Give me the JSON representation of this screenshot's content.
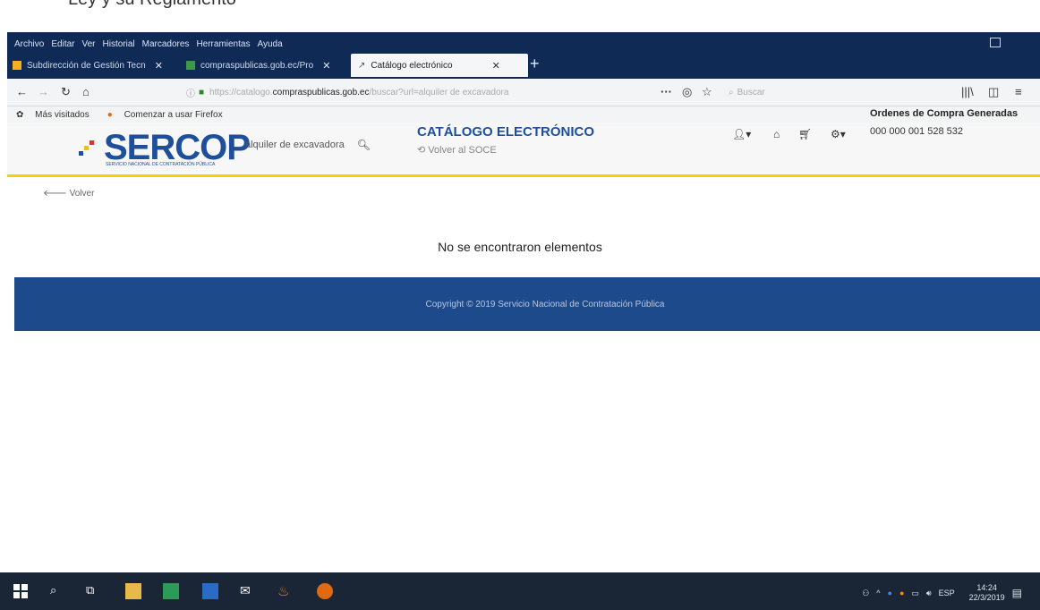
{
  "doc_text": "Ley y su Reglamento",
  "menubar": {
    "items": [
      "Archivo",
      "Editar",
      "Ver",
      "Historial",
      "Marcadores",
      "Herramientas",
      "Ayuda"
    ]
  },
  "tabs": [
    {
      "label": "Subdirección de Gestión Tecn",
      "active": false
    },
    {
      "label": "compraspublicas.gob.ec/Pro",
      "active": false
    },
    {
      "label": "Catálogo electrónico",
      "active": true
    }
  ],
  "navbar": {
    "url_domain": "compraspublicas.gob.ec",
    "url_rest": "/buscar?url=alquiler de excavadora",
    "search_placeholder": "Buscar"
  },
  "bookmarks": {
    "items": [
      "Más visitados",
      "Comenzar a usar Firefox"
    ]
  },
  "site": {
    "logo_text": "SERCOP",
    "logo_sub": "SERVICIO NACIONAL DE CONTRATACIÓN PÚBLICA",
    "search_value": "alquiler de excavadora",
    "catalog_title": "CATÁLOGO ELECTRÓNICO",
    "back_soce": "Volver al SOCE",
    "orders_title": "Ordenes de Compra Generadas",
    "orders_number": "000 000 001 528 532"
  },
  "content": {
    "back_label": "Volver",
    "empty_message": "No se encontraron elementos"
  },
  "footer": {
    "copyright": "Copyright © 2019 Servicio Nacional de Contratación Pública"
  },
  "taskbar": {
    "lang": "ESP",
    "time": "14:24",
    "date": "22/3/2019"
  },
  "colors": {
    "brand_blue": "#1d4f9c",
    "accent_yellow": "#f6d000",
    "footer_blue": "#1d4a8a",
    "chrome_dark": "#0f2a55"
  }
}
